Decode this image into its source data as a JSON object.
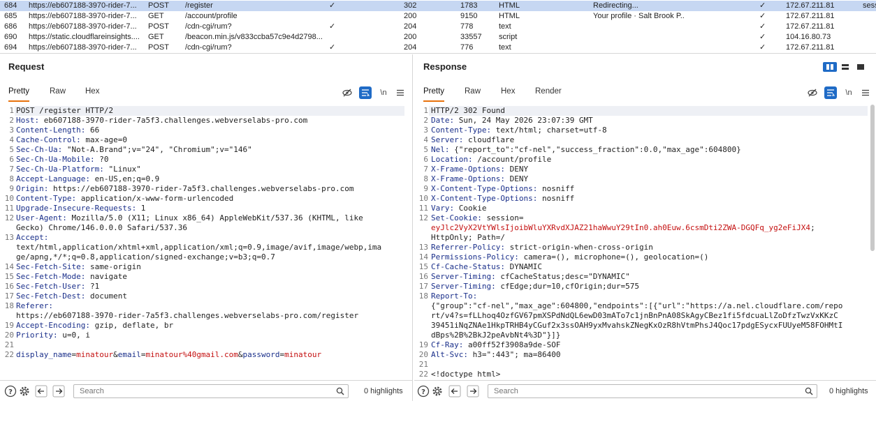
{
  "history": {
    "rows": [
      {
        "num": "684",
        "host": "https://eb607188-3970-rider-7...",
        "method": "POST",
        "url": "/register",
        "edited": "✓",
        "status": "302",
        "length": "1783",
        "mime": "HTML",
        "title": "Redirecting...",
        "tls": "✓",
        "ip": "172.67.211.81",
        "cookies": "sess",
        "selected": true
      },
      {
        "num": "685",
        "host": "https://eb607188-3970-rider-7...",
        "method": "GET",
        "url": "/account/profile",
        "edited": "",
        "status": "200",
        "length": "9150",
        "mime": "HTML",
        "title": "Your profile · Salt Brook P...",
        "tls": "✓",
        "ip": "172.67.211.81",
        "cookies": "",
        "selected": false
      },
      {
        "num": "686",
        "host": "https://eb607188-3970-rider-7...",
        "method": "POST",
        "url": "/cdn-cgi/rum?",
        "edited": "✓",
        "status": "204",
        "length": "778",
        "mime": "text",
        "title": "",
        "tls": "✓",
        "ip": "172.67.211.81",
        "cookies": "",
        "selected": false
      },
      {
        "num": "690",
        "host": "https://static.cloudflareinsights....",
        "method": "GET",
        "url": "/beacon.min.js/v833ccba57c9e4d2798...",
        "edited": "",
        "status": "200",
        "length": "33557",
        "mime": "script",
        "title": "",
        "tls": "✓",
        "ip": "104.16.80.73",
        "cookies": "",
        "selected": false
      },
      {
        "num": "694",
        "host": "https://eb607188-3970-rider-7...",
        "method": "POST",
        "url": "/cdn-cgi/rum?",
        "edited": "✓",
        "status": "204",
        "length": "776",
        "mime": "text",
        "title": "",
        "tls": "✓",
        "ip": "172.67.211.81",
        "cookies": "",
        "selected": false
      }
    ]
  },
  "request": {
    "title": "Request",
    "tabs": [
      "Pretty",
      "Raw",
      "Hex"
    ],
    "active_tab": "Pretty",
    "newline_toggle": "\\n",
    "lines": [
      {
        "n": "1",
        "h": "",
        "v": "POST /register HTTP/2"
      },
      {
        "n": "2",
        "h": "Host:",
        "v": " eb607188-3970-rider-7a5f3.challenges.webverselabs-pro.com"
      },
      {
        "n": "3",
        "h": "Content-Length:",
        "v": " 66"
      },
      {
        "n": "4",
        "h": "Cache-Control:",
        "v": " max-age=0"
      },
      {
        "n": "5",
        "h": "Sec-Ch-Ua:",
        "v": " \"Not-A.Brand\";v=\"24\", \"Chromium\";v=\"146\""
      },
      {
        "n": "6",
        "h": "Sec-Ch-Ua-Mobile:",
        "v": " ?0"
      },
      {
        "n": "7",
        "h": "Sec-Ch-Ua-Platform:",
        "v": " \"Linux\""
      },
      {
        "n": "8",
        "h": "Accept-Language:",
        "v": " en-US,en;q=0.9"
      },
      {
        "n": "9",
        "h": "Origin:",
        "v": " https://eb607188-3970-rider-7a5f3.challenges.webverselabs-pro.com"
      },
      {
        "n": "10",
        "h": "Content-Type:",
        "v": " application/x-www-form-urlencoded"
      },
      {
        "n": "11",
        "h": "Upgrade-Insecure-Requests:",
        "v": " 1"
      },
      {
        "n": "12",
        "h": "User-Agent:",
        "v": " Mozilla/5.0 (X11; Linux x86_64) AppleWebKit/537.36 (KHTML, like"
      },
      {
        "n": "",
        "h": "",
        "v": "Gecko) Chrome/146.0.0.0 Safari/537.36"
      },
      {
        "n": "13",
        "h": "Accept:",
        "v": ""
      },
      {
        "n": "",
        "h": "",
        "v": "text/html,application/xhtml+xml,application/xml;q=0.9,image/avif,image/webp,ima"
      },
      {
        "n": "",
        "h": "",
        "v": "ge/apng,*/*;q=0.8,application/signed-exchange;v=b3;q=0.7"
      },
      {
        "n": "14",
        "h": "Sec-Fetch-Site:",
        "v": " same-origin"
      },
      {
        "n": "15",
        "h": "Sec-Fetch-Mode:",
        "v": " navigate"
      },
      {
        "n": "16",
        "h": "Sec-Fetch-User:",
        "v": " ?1"
      },
      {
        "n": "17",
        "h": "Sec-Fetch-Dest:",
        "v": " document"
      },
      {
        "n": "18",
        "h": "Referer:",
        "v": ""
      },
      {
        "n": "",
        "h": "",
        "v": "https://eb607188-3970-rider-7a5f3.challenges.webverselabs-pro.com/register"
      },
      {
        "n": "19",
        "h": "Accept-Encoding:",
        "v": " gzip, deflate, br"
      },
      {
        "n": "20",
        "h": "Priority:",
        "v": " u=0, i"
      },
      {
        "n": "21",
        "h": "",
        "v": ""
      },
      {
        "n": "22",
        "h": "",
        "v": ""
      }
    ],
    "body_params": [
      {
        "name": "display_name",
        "value": "minatour"
      },
      {
        "name": "email",
        "value": "minatour%40gmail.com"
      },
      {
        "name": "password",
        "value": "minatour"
      }
    ],
    "search_placeholder": "Search",
    "highlights": "0 highlights"
  },
  "response": {
    "title": "Response",
    "tabs": [
      "Pretty",
      "Raw",
      "Hex",
      "Render"
    ],
    "active_tab": "Pretty",
    "newline_toggle": "\\n",
    "lines": [
      {
        "n": "1",
        "h": "",
        "v": "HTTP/2 302 Found",
        "red": false
      },
      {
        "n": "2",
        "h": "Date:",
        "v": " Sun, 24 May 2026 23:07:39 GMT",
        "red": false
      },
      {
        "n": "3",
        "h": "Content-Type:",
        "v": " text/html; charset=utf-8",
        "red": false
      },
      {
        "n": "4",
        "h": "Server:",
        "v": " cloudflare",
        "red": false
      },
      {
        "n": "5",
        "h": "Nel:",
        "v": " {\"report_to\":\"cf-nel\",\"success_fraction\":0.0,\"max_age\":604800}",
        "red": false
      },
      {
        "n": "6",
        "h": "Location:",
        "v": " /account/profile",
        "red": false
      },
      {
        "n": "7",
        "h": "X-Frame-Options:",
        "v": " DENY",
        "red": false
      },
      {
        "n": "8",
        "h": "X-Frame-Options:",
        "v": " DENY",
        "red": false
      },
      {
        "n": "9",
        "h": "X-Content-Type-Options:",
        "v": " nosniff",
        "red": false
      },
      {
        "n": "10",
        "h": "X-Content-Type-Options:",
        "v": " nosniff",
        "red": false
      },
      {
        "n": "11",
        "h": "Vary:",
        "v": " Cookie",
        "red": false
      },
      {
        "n": "12",
        "h": "Set-Cookie:",
        "v": " session=",
        "red": false
      },
      {
        "n": "",
        "h": "",
        "v": "eyJlc2VyX2VtYWlsIjoibWluYXRvdXJAZ21haWwuY29tIn0.ah0Euw.6csmDti2ZWA-DGQFq_yg2eFiJX4",
        "red": true,
        "tail": ";"
      },
      {
        "n": "",
        "h": "",
        "v": "HttpOnly; Path=/",
        "red": false
      },
      {
        "n": "13",
        "h": "Referrer-Policy:",
        "v": " strict-origin-when-cross-origin",
        "red": false
      },
      {
        "n": "14",
        "h": "Permissions-Policy:",
        "v": " camera=(), microphone=(), geolocation=()",
        "red": false
      },
      {
        "n": "15",
        "h": "Cf-Cache-Status:",
        "v": " DYNAMIC",
        "red": false
      },
      {
        "n": "16",
        "h": "Server-Timing:",
        "v": " cfCacheStatus;desc=\"DYNAMIC\"",
        "red": false
      },
      {
        "n": "17",
        "h": "Server-Timing:",
        "v": " cfEdge;dur=10,cfOrigin;dur=575",
        "red": false
      },
      {
        "n": "18",
        "h": "Report-To:",
        "v": "",
        "red": false
      },
      {
        "n": "",
        "h": "",
        "v": "{\"group\":\"cf-nel\",\"max_age\":604800,\"endpoints\":[{\"url\":\"https://a.nel.cloudflare.com/repo",
        "red": false
      },
      {
        "n": "",
        "h": "",
        "v": "rt/v4?s=fLLhoq4OzfGV67pmXSPdNdQL6ewD03mATo7c1jnBnPnA08SkAgyCBez1fi5fdcuaLlZoDfzTwzVxKKzC",
        "red": false
      },
      {
        "n": "",
        "h": "",
        "v": "39451iNqZNAe1HkpTRHB4yCGuf2x3ssOAH9yxMvahskZNegKxOzR8hVtmPhsJ4Qoc17pdgESycxFUUyeM58FOHMtI",
        "red": false
      },
      {
        "n": "",
        "h": "",
        "v": "dBps%2B%2BkJ2peAvbNt4%3D\"}]}",
        "red": false
      },
      {
        "n": "19",
        "h": "Cf-Ray:",
        "v": " a00ff52f3908a9de-SOF",
        "red": false
      },
      {
        "n": "20",
        "h": "Alt-Svc:",
        "v": " h3=\":443\"; ma=86400",
        "red": false
      },
      {
        "n": "21",
        "h": "",
        "v": "",
        "red": false
      },
      {
        "n": "22",
        "h": "",
        "v": "<!doctype html>",
        "red": false
      }
    ],
    "search_placeholder": "Search",
    "highlights": "0 highlights"
  },
  "icons": {
    "help": "help-icon",
    "settings": "gear-icon",
    "back": "arrow-left-icon",
    "forward": "arrow-right-icon",
    "search": "search-icon",
    "hide": "eye-slash-icon",
    "pretty": "pretty-print-icon",
    "menu": "hamburger-icon"
  },
  "colors": {
    "selected_row": "#c6d7f2",
    "accent_blue": "#1f6bc6",
    "tab_underline": "#e8720c",
    "header_name": "#1a2f8a",
    "highlight_red": "#c41010"
  }
}
